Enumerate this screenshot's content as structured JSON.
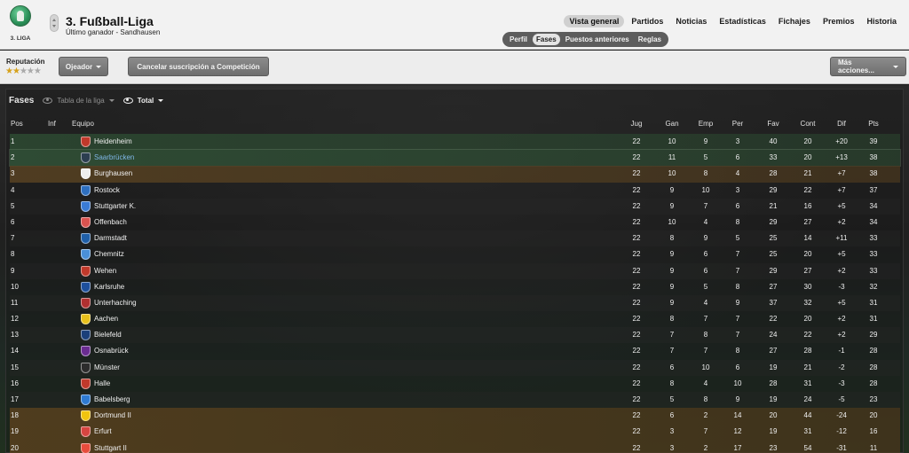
{
  "competition": {
    "logo_caption": "3. LIGA",
    "title": "3. Fußball-Liga",
    "subtitle": "Último ganador - Sandhausen"
  },
  "main_tabs": [
    "Vista general",
    "Partidos",
    "Noticias",
    "Estadísticas",
    "Fichajes",
    "Premios",
    "Historia"
  ],
  "sub_tabs": [
    "Perfil",
    "Fases",
    "Puestos anteriores",
    "Reglas"
  ],
  "toolbar": {
    "reputation_label": "Reputación",
    "reputation_stars": 2,
    "reputation_max": 5,
    "scout_button": "Ojeador",
    "cancel_button": "Cancelar suscripción a Competición",
    "more_button": "Más acciones..."
  },
  "panel": {
    "title": "Fases",
    "view_table": "Tabla de la liga",
    "view_total": "Total"
  },
  "table": {
    "headers": {
      "pos": "Pos",
      "inf": "Inf",
      "team": "Equipo",
      "jug": "Jug",
      "gan": "Gan",
      "emp": "Emp",
      "per": "Per",
      "fav": "Fav",
      "cont": "Cont",
      "dif": "Dif",
      "pts": "Pts"
    },
    "rows": [
      {
        "pos": "1",
        "team": "Heidenheim",
        "jug": "22",
        "gan": "10",
        "emp": "9",
        "per": "3",
        "fav": "40",
        "cont": "20",
        "dif": "+20",
        "pts": "39",
        "zone": "promo",
        "badge": "#c0392b"
      },
      {
        "pos": "2",
        "team": "Saarbrücken",
        "jug": "22",
        "gan": "11",
        "emp": "5",
        "per": "6",
        "fav": "33",
        "cont": "20",
        "dif": "+13",
        "pts": "38",
        "zone": "sel",
        "badge": "#2c3e50"
      },
      {
        "pos": "3",
        "team": "Burghausen",
        "jug": "22",
        "gan": "10",
        "emp": "8",
        "per": "4",
        "fav": "28",
        "cont": "21",
        "dif": "+7",
        "pts": "38",
        "zone": "playoff",
        "badge": "#eeeeee"
      },
      {
        "pos": "4",
        "team": "Rostock",
        "jug": "22",
        "gan": "9",
        "emp": "10",
        "per": "3",
        "fav": "29",
        "cont": "22",
        "dif": "+7",
        "pts": "37",
        "zone": "",
        "badge": "#2e6fbf"
      },
      {
        "pos": "5",
        "team": "Stuttgarter K.",
        "jug": "22",
        "gan": "9",
        "emp": "7",
        "per": "6",
        "fav": "21",
        "cont": "16",
        "dif": "+5",
        "pts": "34",
        "zone": "alt",
        "badge": "#3a7bd5"
      },
      {
        "pos": "6",
        "team": "Offenbach",
        "jug": "22",
        "gan": "10",
        "emp": "4",
        "per": "8",
        "fav": "29",
        "cont": "27",
        "dif": "+2",
        "pts": "34",
        "zone": "",
        "badge": "#d9534f"
      },
      {
        "pos": "7",
        "team": "Darmstadt",
        "jug": "22",
        "gan": "8",
        "emp": "9",
        "per": "5",
        "fav": "25",
        "cont": "14",
        "dif": "+11",
        "pts": "33",
        "zone": "alt",
        "badge": "#1f5fa8"
      },
      {
        "pos": "8",
        "team": "Chemnitz",
        "jug": "22",
        "gan": "9",
        "emp": "6",
        "per": "7",
        "fav": "25",
        "cont": "20",
        "dif": "+5",
        "pts": "33",
        "zone": "",
        "badge": "#4a90d9"
      },
      {
        "pos": "9",
        "team": "Wehen",
        "jug": "22",
        "gan": "9",
        "emp": "6",
        "per": "7",
        "fav": "29",
        "cont": "27",
        "dif": "+2",
        "pts": "33",
        "zone": "alt",
        "badge": "#c0392b"
      },
      {
        "pos": "10",
        "team": "Karlsruhe",
        "jug": "22",
        "gan": "9",
        "emp": "5",
        "per": "8",
        "fav": "27",
        "cont": "30",
        "dif": "-3",
        "pts": "32",
        "zone": "",
        "badge": "#1d4f9c"
      },
      {
        "pos": "11",
        "team": "Unterhaching",
        "jug": "22",
        "gan": "9",
        "emp": "4",
        "per": "9",
        "fav": "37",
        "cont": "32",
        "dif": "+5",
        "pts": "31",
        "zone": "alt",
        "badge": "#b03030"
      },
      {
        "pos": "12",
        "team": "Aachen",
        "jug": "22",
        "gan": "8",
        "emp": "7",
        "per": "7",
        "fav": "22",
        "cont": "20",
        "dif": "+2",
        "pts": "31",
        "zone": "",
        "badge": "#e8c11c"
      },
      {
        "pos": "13",
        "team": "Bielefeld",
        "jug": "22",
        "gan": "7",
        "emp": "8",
        "per": "7",
        "fav": "24",
        "cont": "22",
        "dif": "+2",
        "pts": "29",
        "zone": "alt",
        "badge": "#1b3f7a"
      },
      {
        "pos": "14",
        "team": "Osnabrück",
        "jug": "22",
        "gan": "7",
        "emp": "7",
        "per": "8",
        "fav": "27",
        "cont": "28",
        "dif": "-1",
        "pts": "28",
        "zone": "",
        "badge": "#6a2c91"
      },
      {
        "pos": "15",
        "team": "Münster",
        "jug": "22",
        "gan": "6",
        "emp": "10",
        "per": "6",
        "fav": "19",
        "cont": "21",
        "dif": "-2",
        "pts": "28",
        "zone": "alt",
        "badge": "#2c2c2c"
      },
      {
        "pos": "16",
        "team": "Halle",
        "jug": "22",
        "gan": "8",
        "emp": "4",
        "per": "10",
        "fav": "28",
        "cont": "31",
        "dif": "-3",
        "pts": "28",
        "zone": "",
        "badge": "#c0392b"
      },
      {
        "pos": "17",
        "team": "Babelsberg",
        "jug": "22",
        "gan": "5",
        "emp": "8",
        "per": "9",
        "fav": "19",
        "cont": "24",
        "dif": "-5",
        "pts": "23",
        "zone": "alt",
        "badge": "#2f7ad1"
      },
      {
        "pos": "18",
        "team": "Dortmund II",
        "jug": "22",
        "gan": "6",
        "emp": "2",
        "per": "14",
        "fav": "20",
        "cont": "44",
        "dif": "-24",
        "pts": "20",
        "zone": "releg",
        "badge": "#f1c40f"
      },
      {
        "pos": "19",
        "team": "Erfurt",
        "jug": "22",
        "gan": "3",
        "emp": "7",
        "per": "12",
        "fav": "19",
        "cont": "31",
        "dif": "-12",
        "pts": "16",
        "zone": "releg",
        "badge": "#d64541"
      },
      {
        "pos": "20",
        "team": "Stuttgart II",
        "jug": "22",
        "gan": "3",
        "emp": "2",
        "per": "17",
        "fav": "23",
        "cont": "54",
        "dif": "-31",
        "pts": "11",
        "zone": "releg",
        "badge": "#e74c3c"
      }
    ]
  }
}
